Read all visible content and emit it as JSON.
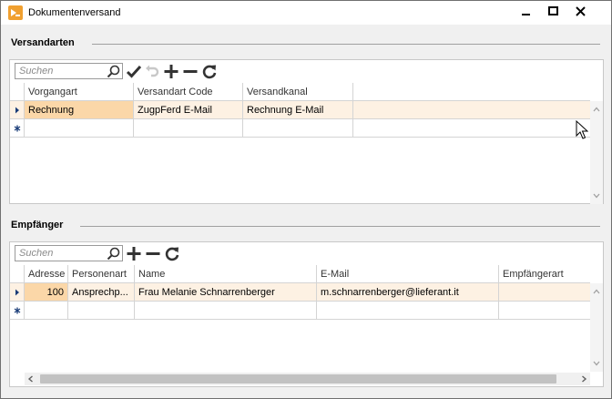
{
  "window": {
    "title": "Dokumentenversand",
    "accent_color": "#fbd7a8"
  },
  "versandarten": {
    "heading": "Versandarten",
    "search_placeholder": "Suchen",
    "columns": [
      "Vorgangart",
      "Versandart Code",
      "Versandkanal"
    ],
    "rows": [
      {
        "vorgangart": "Rechnung",
        "versandart_code": "ZugpFerd E-Mail",
        "versandkanal": "Rechnung E-Mail"
      }
    ]
  },
  "empfaenger": {
    "heading": "Empfänger",
    "search_placeholder": "Suchen",
    "columns": [
      "Adresse",
      "Personenart",
      "Name",
      "E-Mail",
      "Empfängerart"
    ],
    "rows": [
      {
        "adresse": "100",
        "personenart": "Ansprechp...",
        "name": "Frau Melanie Schnarrenberger",
        "email": "m.schnarrenberger@lieferant.it",
        "empfaengerart": ""
      }
    ]
  },
  "icons": {
    "app": "document-send-icon",
    "search": "magnifier-icon",
    "save": "checkmark-icon",
    "undo": "undo-icon",
    "add": "plus-icon",
    "remove": "minus-icon",
    "refresh": "refresh-icon"
  }
}
